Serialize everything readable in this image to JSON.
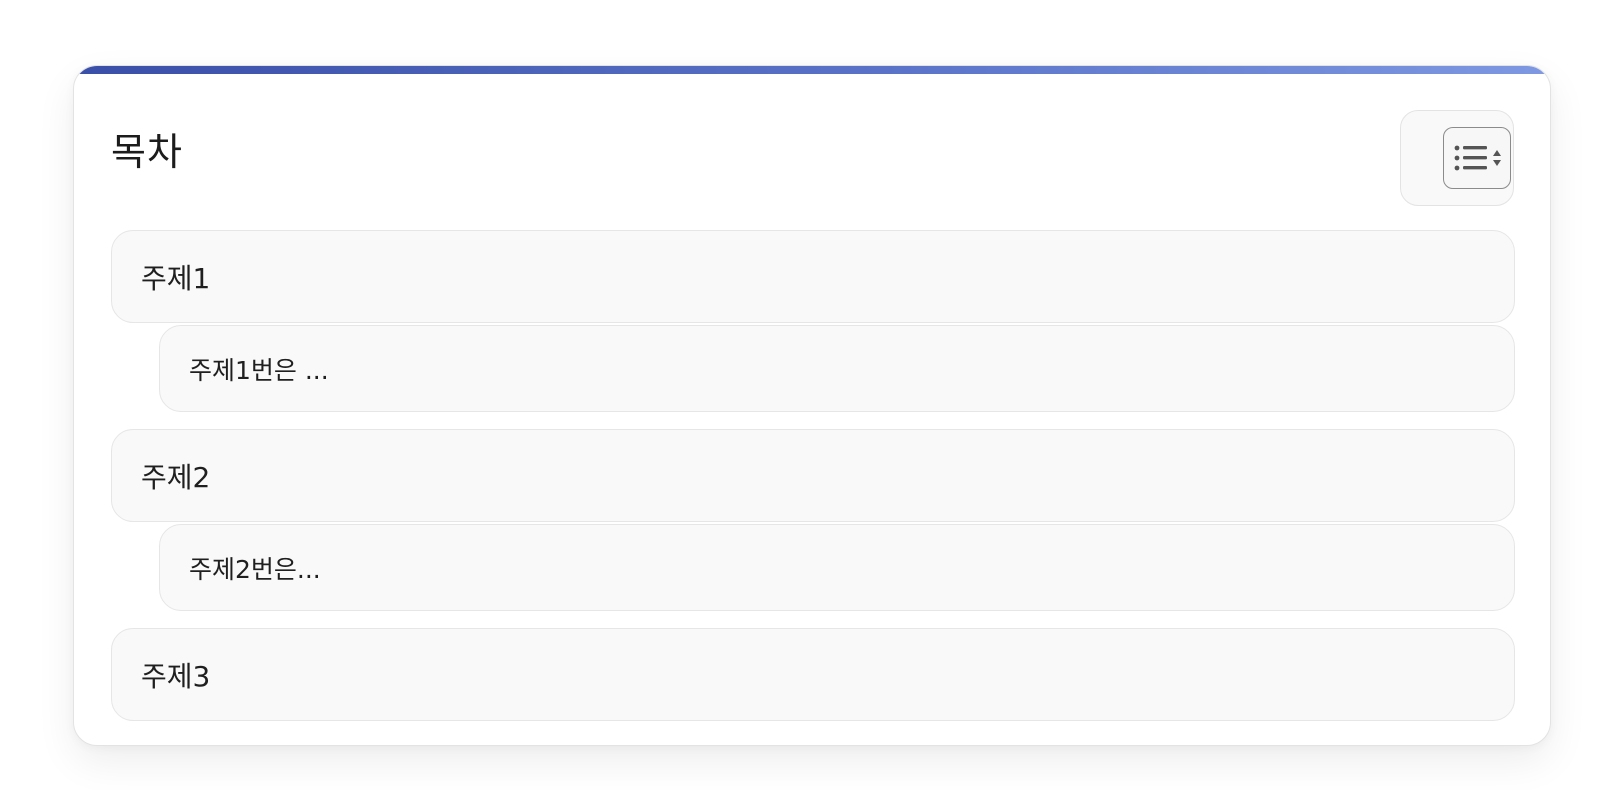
{
  "toc": {
    "title": "목차",
    "toggle_icon": "list-sort-icon",
    "accent_gradient": [
      "#3a4fa8",
      "#5a73c8",
      "#7e98e2"
    ],
    "items": [
      {
        "label": "주제1",
        "level": 1
      },
      {
        "label": "주제1번은 ...",
        "level": 2
      },
      {
        "label": "주제2",
        "level": 1
      },
      {
        "label": "주제2번은...",
        "level": 2
      },
      {
        "label": "주제3",
        "level": 1
      }
    ]
  }
}
